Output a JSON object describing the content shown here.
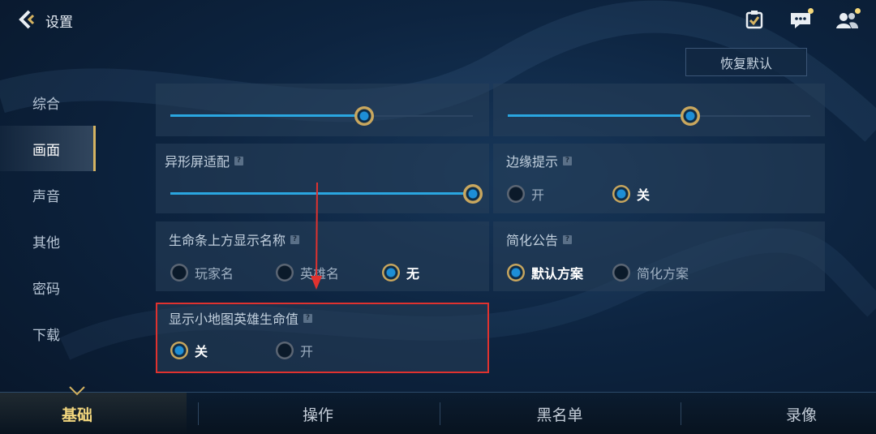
{
  "header": {
    "title": "设置",
    "reset_label": "恢复默认",
    "icons": [
      "back-chevron-icon",
      "checklist-icon",
      "chat-icon",
      "friends-icon"
    ]
  },
  "sidebar": {
    "items": [
      {
        "label": "综合",
        "active": false
      },
      {
        "label": "画面",
        "active": true
      },
      {
        "label": "声音",
        "active": false
      },
      {
        "label": "其他",
        "active": false
      },
      {
        "label": "密码",
        "active": false
      },
      {
        "label": "下载",
        "active": false
      }
    ]
  },
  "settings": {
    "map_brightness": {
      "value": 0.64
    },
    "skill_brightness": {
      "value": 0.603
    },
    "notch_adapt": {
      "title": "异形屏适配",
      "value": 1.0
    },
    "edge_hint": {
      "title": "边缘提示",
      "options": [
        "开",
        "关"
      ],
      "selected": 1
    },
    "health_bar_name": {
      "title": "生命条上方显示名称",
      "options": [
        "玩家名",
        "英雄名",
        "无"
      ],
      "selected": 2
    },
    "simplified_notice": {
      "title": "简化公告",
      "options": [
        "默认方案",
        "简化方案"
      ],
      "selected": 0
    },
    "minimap_hero_hp": {
      "title": "显示小地图英雄生命值",
      "options": [
        "关",
        "开"
      ],
      "selected": 0
    }
  },
  "bottom_tabs": [
    {
      "label": "基础",
      "active": true
    },
    {
      "label": "操作",
      "active": false
    },
    {
      "label": "黑名单",
      "active": false
    },
    {
      "label": "录像",
      "active": false
    }
  ],
  "colors": {
    "accent_gold": "#d6b462",
    "slider_blue": "#2aa6e0",
    "highlight_red": "#e0322f",
    "bg_dark": "#0d2440"
  }
}
